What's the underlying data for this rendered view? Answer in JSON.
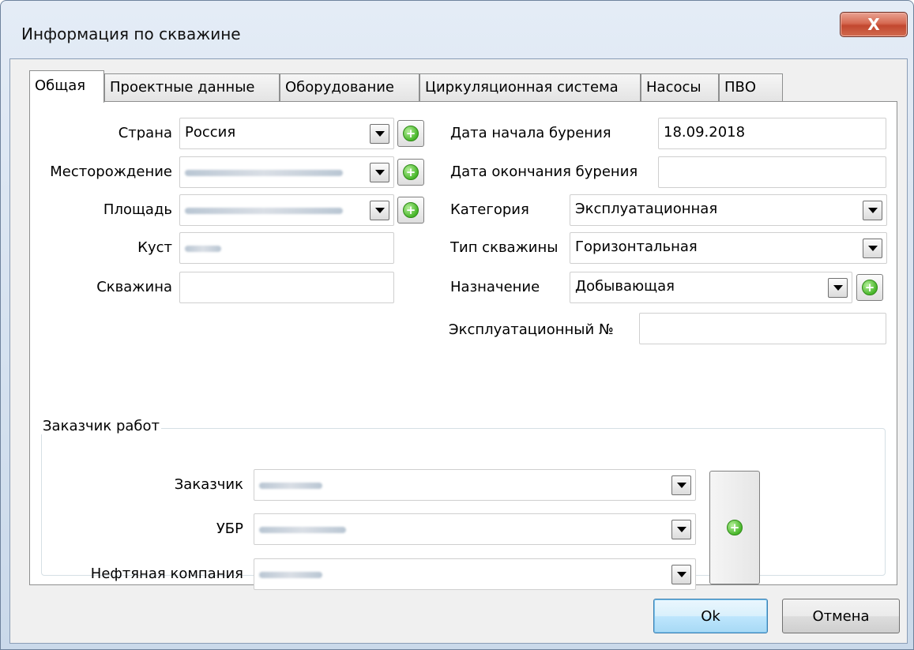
{
  "window": {
    "title": "Информация по скважине",
    "close_label": "X"
  },
  "tabs": [
    "Общая",
    "Проектные данные",
    "Оборудование",
    "Циркуляционная система",
    "Насосы",
    "ПВО"
  ],
  "left": {
    "country_label": "Страна",
    "country_value": "Россия",
    "field_label": "Месторождение",
    "area_label": "Площадь",
    "pad_label": "Куст",
    "well_label": "Скважина",
    "well_value": ""
  },
  "right": {
    "start_label": "Дата начала бурения",
    "start_value": "18.09.2018",
    "end_label": "Дата окончания бурения",
    "end_value": "",
    "category_label": "Категория",
    "category_value": "Эксплуатационная",
    "type_label": "Тип скважины",
    "type_value": "Горизонтальная",
    "purpose_label": "Назначение",
    "purpose_value": "Добывающая",
    "op_no_label": "Эксплуатационный №",
    "op_no_value": ""
  },
  "customer": {
    "group_title": "Заказчик работ",
    "customer_label": "Заказчик",
    "ubr_label": "УБР",
    "oil_company_label": "Нефтяная компания"
  },
  "buttons": {
    "ok": "Ok",
    "cancel": "Отмена"
  },
  "icons": {
    "add": "add-green-plus-icon",
    "dropdown": "dropdown-arrow-icon",
    "close": "close-icon"
  },
  "colors": {
    "add_icon": "#48b62a",
    "close_button": "#c2472f",
    "default_button": "#bee6fd"
  }
}
